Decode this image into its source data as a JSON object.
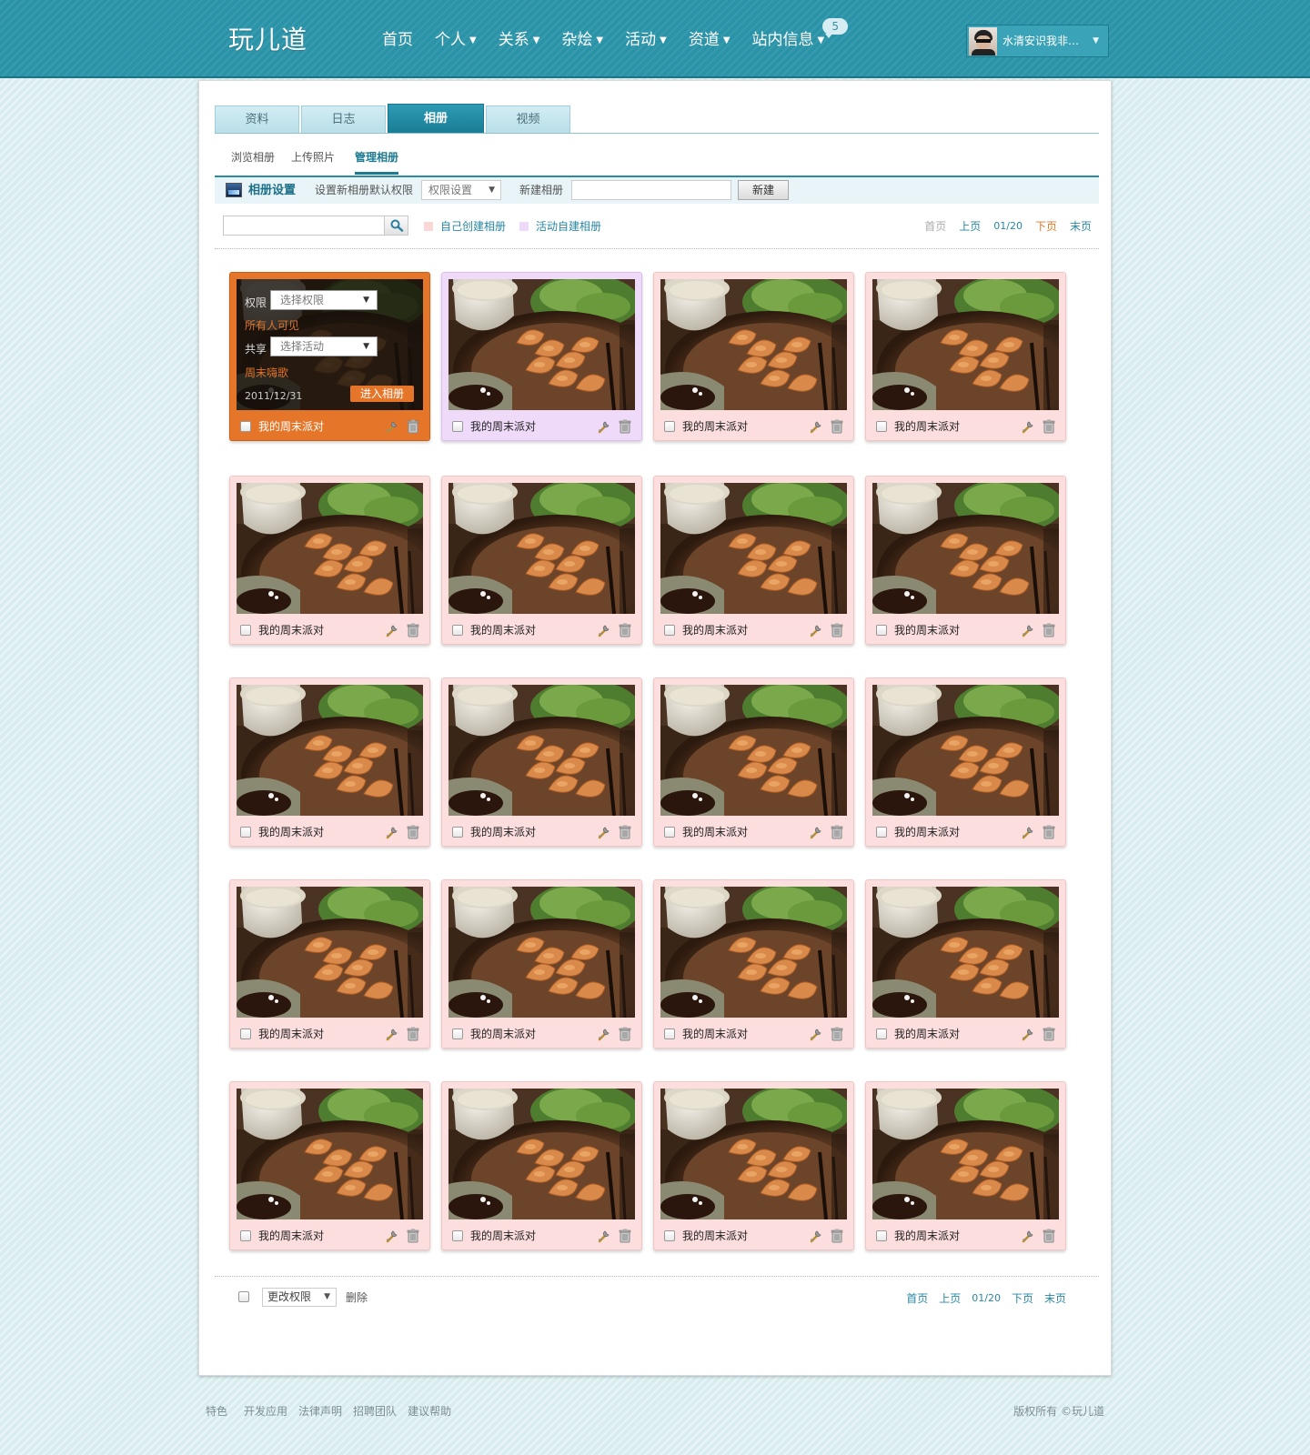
{
  "header": {
    "logo": "玩儿道",
    "nav": [
      {
        "label": "首页",
        "caret": false
      },
      {
        "label": "个人",
        "caret": true
      },
      {
        "label": "关系",
        "caret": true
      },
      {
        "label": "杂烩",
        "caret": true
      },
      {
        "label": "活动",
        "caret": true
      },
      {
        "label": "资道",
        "caret": true
      },
      {
        "label": "站内信息",
        "caret": true,
        "badge": "5"
      }
    ],
    "user": {
      "name": "水清安识我非…"
    }
  },
  "tabs": [
    {
      "label": "资料",
      "active": false
    },
    {
      "label": "日志",
      "active": false
    },
    {
      "label": "相册",
      "active": true
    },
    {
      "label": "视频",
      "active": false
    }
  ],
  "subtabs": [
    {
      "label": "浏览相册",
      "active": false
    },
    {
      "label": "上传照片",
      "active": false
    },
    {
      "label": "管理相册",
      "active": true
    }
  ],
  "settings": {
    "title": "相册设置",
    "default_perm_label": "设置新相册默认权限",
    "perm_select": "权限设置",
    "new_album_label": "新建相册",
    "new_album_input": "",
    "new_button": "新建"
  },
  "search": {
    "value": "",
    "placeholder": ""
  },
  "legend": [
    {
      "label": "自己创建相册",
      "color": "#fbd8d8"
    },
    {
      "label": "活动自建相册",
      "color": "#efd9fa"
    }
  ],
  "pager_top": {
    "first": "首页",
    "prev": "上页",
    "page": "01/20",
    "next": "下页",
    "last": "末页"
  },
  "selected_overlay": {
    "perm_label": "权限",
    "perm_select": "选择权限",
    "perm_hint": "所有人可见",
    "share_label": "共享",
    "share_select": "选择活动",
    "share_hint": "周末嗨歌",
    "date": "2011/12/31",
    "enter_button": "进入相册"
  },
  "albums": [
    {
      "title": "我的周末派对",
      "type": "own",
      "selected": true
    },
    {
      "title": "我的周末派对",
      "type": "activity",
      "selected": false
    },
    {
      "title": "我的周末派对",
      "type": "own",
      "selected": false
    },
    {
      "title": "我的周末派对",
      "type": "own",
      "selected": false
    },
    {
      "title": "我的周末派对",
      "type": "own",
      "selected": false
    },
    {
      "title": "我的周末派对",
      "type": "own",
      "selected": false
    },
    {
      "title": "我的周末派对",
      "type": "own",
      "selected": false
    },
    {
      "title": "我的周末派对",
      "type": "own",
      "selected": false
    },
    {
      "title": "我的周末派对",
      "type": "own",
      "selected": false
    },
    {
      "title": "我的周末派对",
      "type": "own",
      "selected": false
    },
    {
      "title": "我的周末派对",
      "type": "own",
      "selected": false
    },
    {
      "title": "我的周末派对",
      "type": "own",
      "selected": false
    },
    {
      "title": "我的周末派对",
      "type": "own",
      "selected": false
    },
    {
      "title": "我的周末派对",
      "type": "own",
      "selected": false
    },
    {
      "title": "我的周末派对",
      "type": "own",
      "selected": false
    },
    {
      "title": "我的周末派对",
      "type": "own",
      "selected": false
    },
    {
      "title": "我的周末派对",
      "type": "own",
      "selected": false
    },
    {
      "title": "我的周末派对",
      "type": "own",
      "selected": false
    },
    {
      "title": "我的周末派对",
      "type": "own",
      "selected": false
    },
    {
      "title": "我的周末派对",
      "type": "own",
      "selected": false
    }
  ],
  "bottom": {
    "perm_select": "更改权限",
    "delete_label": "删除"
  },
  "pager_bottom": {
    "first": "首页",
    "prev": "上页",
    "page": "01/20",
    "next": "下页",
    "last": "末页"
  },
  "footer": {
    "links": [
      "特色",
      "开发应用",
      "法律声明",
      "招聘团队",
      "建议帮助"
    ],
    "copyright": "版权所有 ©玩儿道"
  },
  "colors": {
    "header_bg": "#2a93a8",
    "accent": "#1c7a91",
    "own_album_bg": "#fddede",
    "activity_album_bg": "#f0dafa",
    "selected_album_bg": "#e57629",
    "link": "#2a87a3",
    "next_link": "#e07826"
  },
  "icons": {
    "card_edit": "wrench-icon",
    "card_delete": "trash-icon",
    "search": "search-icon",
    "settings": "album-settings-icon"
  }
}
